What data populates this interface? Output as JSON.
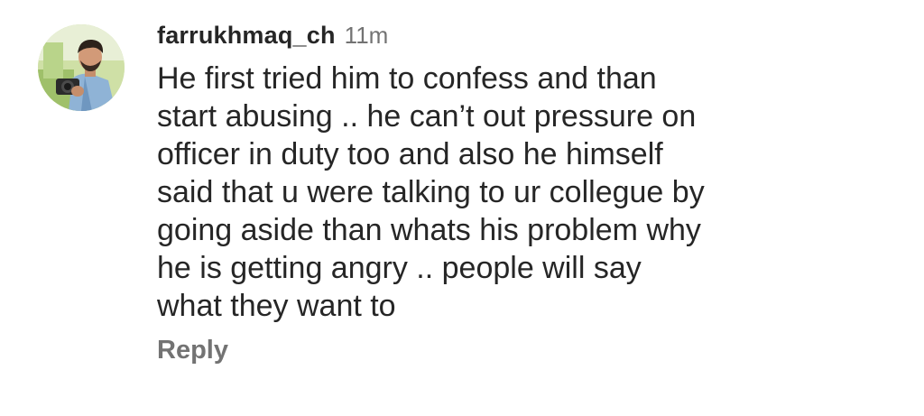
{
  "comment": {
    "username": "farrukhmaq_ch",
    "timestamp": "11m",
    "text": "He first tried him to confess and than\nstart abusing .. he can’t out pressure on\nofficer in duty too and also he himself\nsaid that u were talking to ur collegue by\ngoing aside than whats his problem why\nhe is getting angry .. people will say\nwhat they want to",
    "reply_label": "Reply"
  },
  "colors": {
    "primary_text": "#262626",
    "secondary_text": "#737373",
    "background": "#ffffff"
  },
  "icons": {
    "avatar": "profile-photo"
  }
}
